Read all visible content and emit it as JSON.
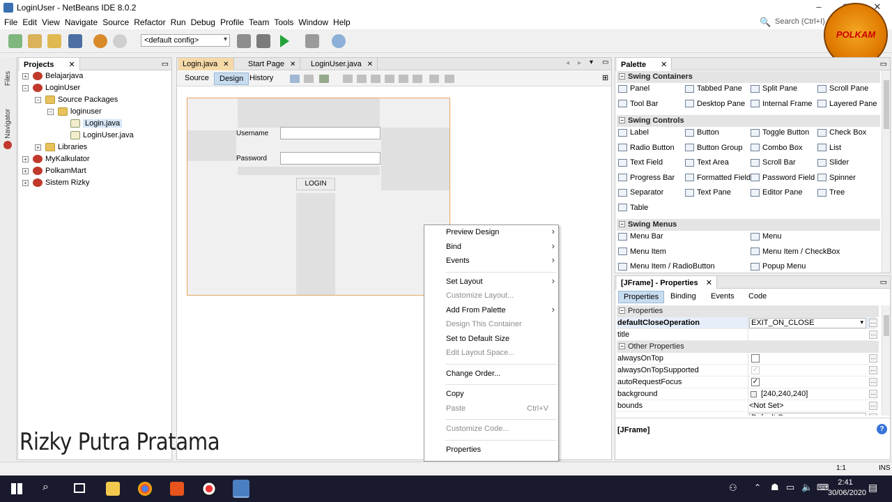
{
  "window": {
    "title": "LoginUser - NetBeans IDE 8.0.2"
  },
  "menubar": [
    "File",
    "Edit",
    "View",
    "Navigate",
    "Source",
    "Refactor",
    "Run",
    "Debug",
    "Profile",
    "Team",
    "Tools",
    "Window",
    "Help"
  ],
  "search": {
    "placeholder": "Search (Ctrl+I)"
  },
  "toolbar": {
    "config": "<default config>"
  },
  "logo": {
    "text": "POLKAM"
  },
  "left_strip": {
    "files": "Files",
    "navigator": "Navigator"
  },
  "projects": {
    "tab": "Projects",
    "tree": [
      {
        "label": "Belajarjava",
        "level": 0,
        "exp": "+",
        "icon": "proj"
      },
      {
        "label": "LoginUser",
        "level": 0,
        "exp": "−",
        "icon": "proj"
      },
      {
        "label": "Source Packages",
        "level": 1,
        "exp": "−",
        "icon": "pkg"
      },
      {
        "label": "loginuser",
        "level": 2,
        "exp": "−",
        "icon": "pkg"
      },
      {
        "label": "Login.java",
        "level": 3,
        "exp": "",
        "icon": "java",
        "selected": true
      },
      {
        "label": "LoginUser.java",
        "level": 3,
        "exp": "",
        "icon": "java"
      },
      {
        "label": "Libraries",
        "level": 1,
        "exp": "+",
        "icon": "lib"
      },
      {
        "label": "MyKalkulator",
        "level": 0,
        "exp": "+",
        "icon": "proj"
      },
      {
        "label": "PolkamMart",
        "level": 0,
        "exp": "+",
        "icon": "proj"
      },
      {
        "label": "Sistem Rizky",
        "level": 0,
        "exp": "+",
        "icon": "proj"
      }
    ]
  },
  "editor": {
    "tabs": [
      "Login.java",
      "Start Page",
      "LoginUser.java"
    ],
    "modes": [
      "Source",
      "Design",
      "History"
    ],
    "form": {
      "username_label": "Username",
      "password_label": "Password",
      "login_button": "LOGIN"
    }
  },
  "context_menu": {
    "items": [
      {
        "label": "Preview Design",
        "sub": true
      },
      {
        "label": "Bind",
        "sub": true
      },
      {
        "label": "Events",
        "sub": true
      },
      {
        "sep": true
      },
      {
        "label": "Set Layout",
        "sub": true
      },
      {
        "label": "Customize Layout...",
        "disabled": true
      },
      {
        "label": "Add From Palette",
        "sub": true
      },
      {
        "label": "Design This Container",
        "disabled": true
      },
      {
        "label": "Set to Default Size"
      },
      {
        "label": "Edit Layout Space...",
        "disabled": true
      },
      {
        "sep": true
      },
      {
        "label": "Change Order..."
      },
      {
        "sep": true
      },
      {
        "label": "Copy"
      },
      {
        "label": "Paste",
        "disabled": true,
        "shortcut": "Ctrl+V"
      },
      {
        "sep": true
      },
      {
        "label": "Customize Code...",
        "disabled": true
      },
      {
        "sep": true
      },
      {
        "label": "Properties"
      }
    ]
  },
  "palette": {
    "tab": "Palette",
    "categories": [
      {
        "name": "Swing Containers",
        "items": [
          "Panel",
          "Tabbed Pane",
          "Split Pane",
          "Scroll Pane",
          "Tool Bar",
          "Desktop Pane",
          "Internal Frame",
          "Layered Pane"
        ]
      },
      {
        "name": "Swing Controls",
        "items": [
          "Label",
          "Button",
          "Toggle Button",
          "Check Box",
          "Radio Button",
          "Button Group",
          "Combo Box",
          "List",
          "Text Field",
          "Text Area",
          "Scroll Bar",
          "Slider",
          "Progress Bar",
          "Formatted Field",
          "Password Field",
          "Spinner",
          "Separator",
          "Text Pane",
          "Editor Pane",
          "Tree",
          "Table"
        ]
      },
      {
        "name": "Swing Menus",
        "items": [
          "Menu Bar",
          "",
          "Menu",
          "",
          "Menu Item",
          "",
          "Menu Item / CheckBox",
          "",
          "Menu Item / RadioButton",
          "",
          "Popup Menu",
          ""
        ]
      }
    ]
  },
  "properties": {
    "tab": "[JFrame] - Properties",
    "subtabs": [
      "Properties",
      "Binding",
      "Events",
      "Code"
    ],
    "section1": "Properties",
    "section2": "Other Properties",
    "rows": [
      {
        "key": "defaultCloseOperation",
        "value": "EXIT_ON_CLOSE",
        "selected": true
      },
      {
        "key": "title",
        "value": ""
      },
      {
        "key": "alwaysOnTop",
        "value": "",
        "check": "off"
      },
      {
        "key": "alwaysOnTopSupported",
        "value": "",
        "check": "grey"
      },
      {
        "key": "autoRequestFocus",
        "value": "",
        "check": "on"
      },
      {
        "key": "background",
        "value": "[240,240,240]"
      },
      {
        "key": "bounds",
        "value": "<Not Set>"
      },
      {
        "key": "cursor",
        "value": "Default Cursor"
      }
    ],
    "footer": "[JFrame]"
  },
  "statusbar": {
    "position": "1:1",
    "mode": "INS"
  },
  "watermark": "Rizky Putra Pratama",
  "clock": {
    "time": "2:41",
    "date": "30/06/2020"
  },
  "colors": {
    "accent": "#3874d8",
    "selection": "#d5e6f7",
    "taskbar": "#1a1a2e"
  }
}
